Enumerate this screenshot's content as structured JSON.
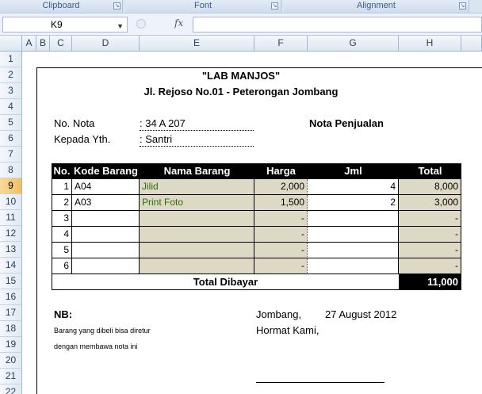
{
  "ribbon": {
    "groups": [
      "Clipboard",
      "Font",
      "Alignment"
    ]
  },
  "formula_bar": {
    "name_box": "K9",
    "fx": "fx",
    "value": ""
  },
  "columns": [
    "A",
    "B",
    "C",
    "D",
    "E",
    "F",
    "G",
    "H"
  ],
  "rows": [
    "1",
    "2",
    "3",
    "4",
    "5",
    "6",
    "7",
    "8",
    "9",
    "10",
    "11",
    "12",
    "13",
    "14",
    "15",
    "16",
    "17",
    "18",
    "19",
    "20",
    "21",
    "22"
  ],
  "header": {
    "title": "\"LAB MANJOS\"",
    "address": "Jl. Rejoso No.01 - Peterongan Jombang"
  },
  "meta": {
    "nota_label": "No. Nota",
    "nota_value": ": 34 A 207",
    "kepada_label": "Kepada Yth.",
    "kepada_value": ": Santri",
    "doc_type": "Nota Penjualan"
  },
  "table": {
    "headers": [
      "No.",
      "Kode Barang",
      "Nama Barang",
      "Harga",
      "Jml",
      "Total"
    ],
    "rows": [
      {
        "no": "1",
        "kode": "A04",
        "nama": "Jilid",
        "harga": "2,000",
        "jml": "4",
        "total": "8,000"
      },
      {
        "no": "2",
        "kode": "A03",
        "nama": "Print Foto",
        "harga": "1,500",
        "jml": "2",
        "total": "3,000"
      },
      {
        "no": "3",
        "kode": "",
        "nama": "",
        "harga": "-",
        "jml": "",
        "total": "-"
      },
      {
        "no": "4",
        "kode": "",
        "nama": "",
        "harga": "-",
        "jml": "",
        "total": "-"
      },
      {
        "no": "5",
        "kode": "",
        "nama": "",
        "harga": "-",
        "jml": "",
        "total": "-"
      },
      {
        "no": "6",
        "kode": "",
        "nama": "",
        "harga": "-",
        "jml": "",
        "total": "-"
      }
    ],
    "total_label": "Total Dibayar",
    "total_value": "11,000"
  },
  "footer": {
    "nb_label": "NB:",
    "nb_line1": "Barang yang dibeli bisa diretur",
    "nb_line2": "dengan membawa nota ini",
    "city": "Jombang,",
    "date": "27 August 2012",
    "closing": "Hormat Kami,"
  }
}
